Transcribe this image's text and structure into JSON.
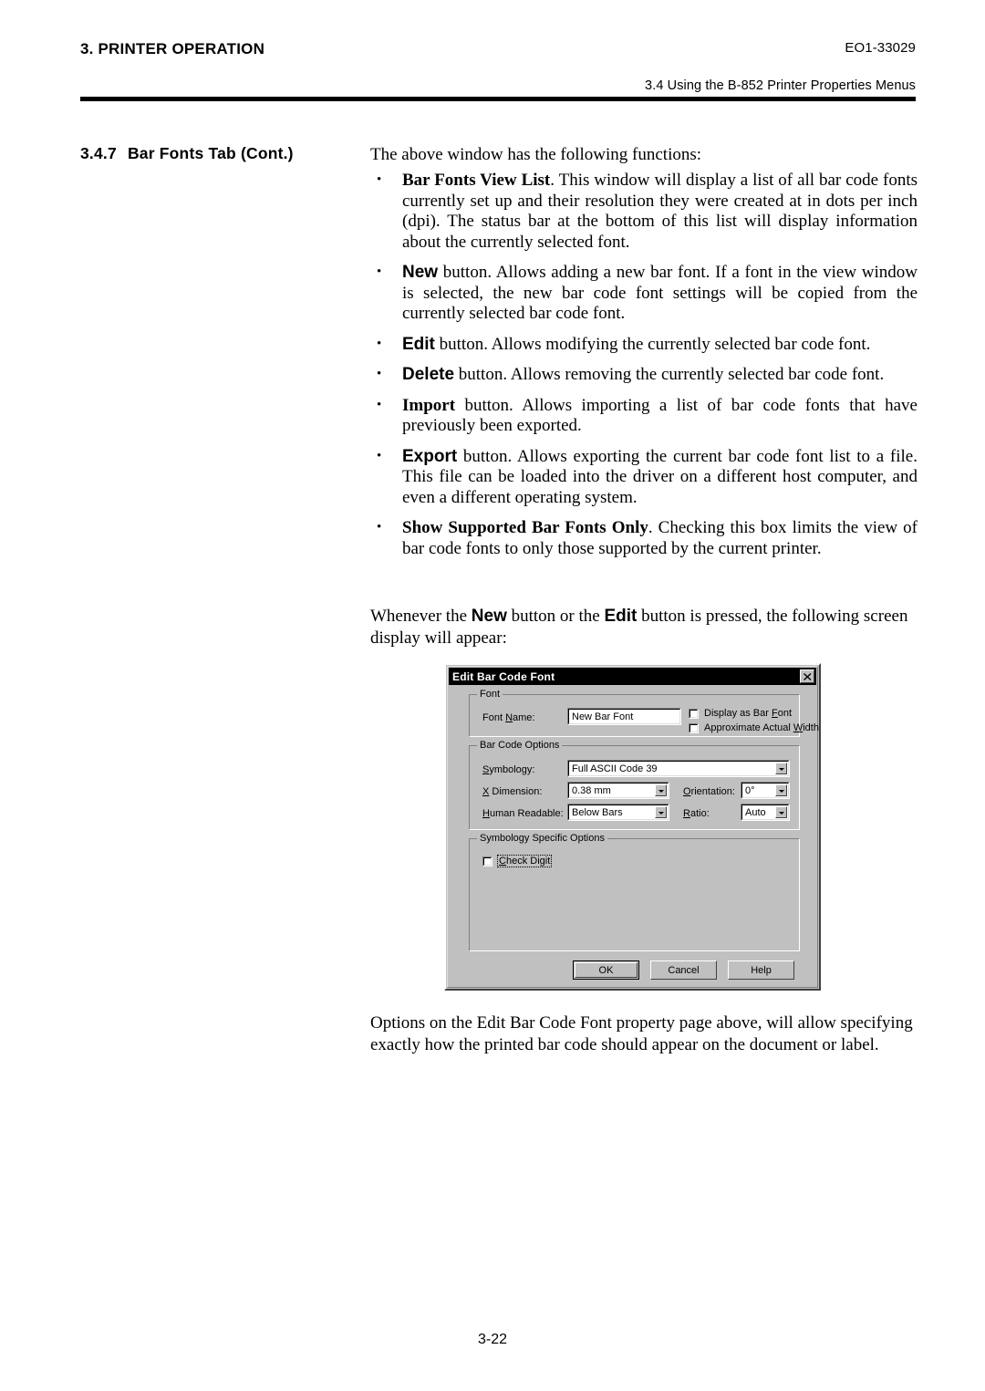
{
  "header": {
    "chapter": "3. PRINTER OPERATION",
    "doc_code": "EO1-33029",
    "subtitle": "3.4 Using the B-852 Printer Properties Menus"
  },
  "section": {
    "number": "3.4.7",
    "title": "Bar Fonts Tab (Cont.)"
  },
  "body": {
    "lead": "The above window has the following functions:",
    "bullets": [
      {
        "term": "Bar Fonts View List",
        "term_style": "serif",
        "text": ". This window will display a list of all bar code fonts currently set up and their resolution they were created at in dots per inch (dpi). The status bar at the bottom of this list will display information about the currently selected font."
      },
      {
        "term": "New",
        "term_style": "sans",
        "text": " button. Allows adding a new bar font.  If a font in the view window is selected, the new bar code font settings will be copied from the currently selected bar code font."
      },
      {
        "term": "Edit",
        "term_style": "sans",
        "text": " button. Allows modifying the currently selected bar code font."
      },
      {
        "term": "Delete",
        "term_style": "sans",
        "text": " button. Allows removing the currently selected bar code font."
      },
      {
        "term": "Import",
        "term_style": "serif",
        "text": " button. Allows importing a list of bar code fonts that have  previously been exported."
      },
      {
        "term": "Export",
        "term_style": "sans",
        "text": " button. Allows exporting the current bar code font list to a file. This file can be loaded into the driver on a different host computer, and even a different operating system."
      },
      {
        "term": "Show Supported Bar Fonts Only",
        "term_style": "serif",
        "text": ". Checking this box limits the view of bar code fonts to only those supported by the current printer."
      }
    ],
    "whenever": {
      "part1": "Whenever the ",
      "btn1": "New",
      "part2": " button or the ",
      "btn2": "Edit",
      "part3": " button is pressed, the following screen display will appear:"
    },
    "options_paragraph": "Options on the Edit Bar Code Font property page above, will allow specifying exactly how the printed bar code should appear on the document or label."
  },
  "dialog": {
    "title": "Edit Bar Code Font",
    "close_icon": "close-icon",
    "font_group": {
      "legend": "Font",
      "font_name_label_pre": "Font ",
      "font_name_label_mnemonic": "N",
      "font_name_label_post": "ame:",
      "font_name_value": "New Bar Font",
      "checkboxes": [
        {
          "pre": "Display as Bar ",
          "mnemonic": "F",
          "post": "ont",
          "checked": false
        },
        {
          "pre": "Approximate Actual ",
          "mnemonic": "W",
          "post": "idth",
          "checked": false
        }
      ]
    },
    "barcode_group": {
      "legend": "Bar Code Options",
      "symbology_label_pre": "",
      "symbology_label_mnemonic": "S",
      "symbology_label_post": "ymbology:",
      "symbology_value": "Full ASCII Code 39",
      "xdim_label_mnemonic": "X",
      "xdim_label_post": " Dimension:",
      "xdim_value": "0.38 mm",
      "orientation_label_mnemonic": "O",
      "orientation_label_post": "rientation:",
      "orientation_value": "0°",
      "human_label_mnemonic": "H",
      "human_label_post": "uman Readable:",
      "human_value": "Below Bars",
      "ratio_label_mnemonic": "R",
      "ratio_label_post": "atio:",
      "ratio_value": "Auto"
    },
    "symspec_group": {
      "legend": "Symbology Specific Options",
      "check_digit": {
        "pre": "",
        "mnemonic": "C",
        "post": "heck Digit",
        "checked": false,
        "focused": true
      }
    },
    "buttons": {
      "ok": "OK",
      "cancel": "Cancel",
      "help": "Help"
    }
  },
  "footer": {
    "page_number": "3-22"
  }
}
